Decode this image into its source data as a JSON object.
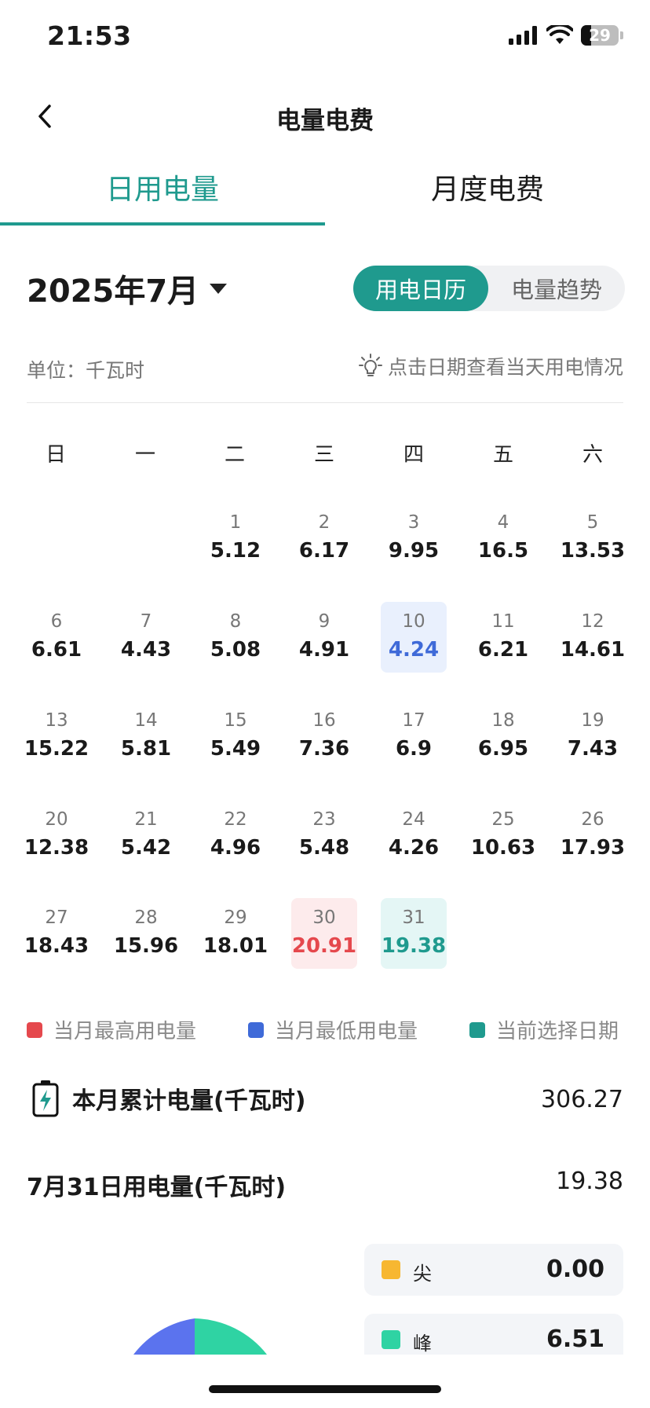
{
  "status_bar": {
    "time": "21:53",
    "battery": "29"
  },
  "nav": {
    "title": "电量电费"
  },
  "tabs": [
    {
      "label": "日用电量",
      "active": true
    },
    {
      "label": "月度电费",
      "active": false
    }
  ],
  "month_picker": {
    "label": "2025年7月"
  },
  "view_toggle": {
    "calendar": "用电日历",
    "trend": "电量趋势"
  },
  "unit_label": "单位：千瓦时",
  "hint": "点击日期查看当天用电情况",
  "weekdays": [
    "日",
    "一",
    "二",
    "三",
    "四",
    "五",
    "六"
  ],
  "calendar": [
    {
      "day": "1",
      "value": "5.12"
    },
    {
      "day": "2",
      "value": "6.17"
    },
    {
      "day": "3",
      "value": "9.95"
    },
    {
      "day": "4",
      "value": "16.5"
    },
    {
      "day": "5",
      "value": "13.53"
    },
    {
      "day": "6",
      "value": "6.61"
    },
    {
      "day": "7",
      "value": "4.43"
    },
    {
      "day": "8",
      "value": "5.08"
    },
    {
      "day": "9",
      "value": "4.91"
    },
    {
      "day": "10",
      "value": "4.24",
      "state": "low"
    },
    {
      "day": "11",
      "value": "6.21"
    },
    {
      "day": "12",
      "value": "14.61"
    },
    {
      "day": "13",
      "value": "15.22"
    },
    {
      "day": "14",
      "value": "5.81"
    },
    {
      "day": "15",
      "value": "5.49"
    },
    {
      "day": "16",
      "value": "7.36"
    },
    {
      "day": "17",
      "value": "6.9"
    },
    {
      "day": "18",
      "value": "6.95"
    },
    {
      "day": "19",
      "value": "7.43"
    },
    {
      "day": "20",
      "value": "12.38"
    },
    {
      "day": "21",
      "value": "5.42"
    },
    {
      "day": "22",
      "value": "4.96"
    },
    {
      "day": "23",
      "value": "5.48"
    },
    {
      "day": "24",
      "value": "4.26"
    },
    {
      "day": "25",
      "value": "10.63"
    },
    {
      "day": "26",
      "value": "17.93"
    },
    {
      "day": "27",
      "value": "18.43"
    },
    {
      "day": "28",
      "value": "15.96"
    },
    {
      "day": "29",
      "value": "18.01"
    },
    {
      "day": "30",
      "value": "20.91",
      "state": "high"
    },
    {
      "day": "31",
      "value": "19.38",
      "state": "selected"
    }
  ],
  "legend": [
    {
      "label": "当月最高用电量",
      "color": "#e5484d"
    },
    {
      "label": "当月最低用电量",
      "color": "#3f6ad8"
    },
    {
      "label": "当前选择日期",
      "color": "#1f9a8e"
    }
  ],
  "summary": {
    "month_total_label": "本月累计电量(千瓦时)",
    "month_total_value": "306.27",
    "day_label": "7月31日用电量(千瓦时)",
    "day_value": "19.38"
  },
  "tou": [
    {
      "label": "尖",
      "value": "0.00",
      "color": "#f7b731"
    },
    {
      "label": "峰",
      "value": "6.51",
      "color": "#2fd3a3"
    }
  ],
  "donut_colors": {
    "a": "#5b73ee",
    "b": "#2fd3a3"
  }
}
